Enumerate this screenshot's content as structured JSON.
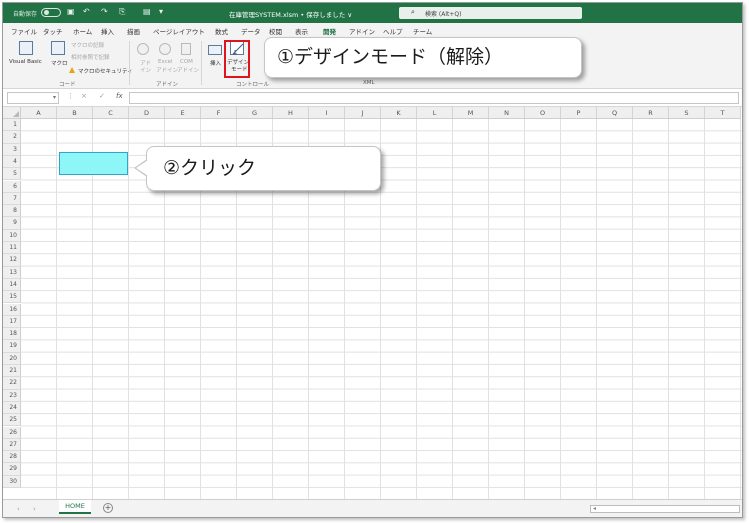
{
  "colors": {
    "title_bar": "#217346",
    "button_shape": "#8ff6f7",
    "highlight": "#e0141c"
  },
  "title_bar": {
    "autosave": "自動保存",
    "autosave_state": "オフ",
    "filename": "在庫管理SYSTEM.xlsm • 保存しました ∨",
    "search_placeholder": "検索 (Alt+Q)"
  },
  "menu_tabs": [
    "ファイル",
    "タッチ",
    "ホーム",
    "挿入",
    "描画",
    "ページレイアウト",
    "数式",
    "データ",
    "校閲",
    "表示",
    "開発",
    "アドイン",
    "ヘルプ",
    "チーム"
  ],
  "active_tab": "開発",
  "ribbon": {
    "code": {
      "visual_basic": "Visual Basic",
      "macro": "マクロ",
      "record_macro": "マクロの記録",
      "relative_ref": "相対参照で記録",
      "macro_security": "マクロのセキュリティ",
      "group_label": "コード"
    },
    "addins": {
      "addins_label": [
        "アド",
        "イン"
      ],
      "excel_addins": [
        "Excel",
        "アドイン"
      ],
      "com_addins": [
        "COM",
        "アドイン"
      ],
      "group_label": "アドイン"
    },
    "controls": {
      "insert": "挿入",
      "design_mode": [
        "デザイン",
        "モード"
      ],
      "group_label": "コントロール"
    },
    "xml_group_label": "XML"
  },
  "formula_bar": {
    "fx": "fx",
    "cancel": "×",
    "enter": "✓"
  },
  "columns": [
    "A",
    "B",
    "C",
    "D",
    "E",
    "F",
    "G",
    "H",
    "I",
    "J",
    "K",
    "L",
    "M",
    "N",
    "O",
    "P",
    "Q",
    "R",
    "S",
    "T"
  ],
  "rows": [
    "1",
    "2",
    "3",
    "4",
    "5",
    "6",
    "7",
    "8",
    "9",
    "10",
    "11",
    "12",
    "13",
    "14",
    "15",
    "16",
    "17",
    "18",
    "19",
    "20",
    "21",
    "22",
    "23",
    "24",
    "25",
    "26",
    "27",
    "28",
    "29",
    "30"
  ],
  "sheet_tabs": {
    "active": "HOME",
    "add": "+"
  },
  "callouts": {
    "step1": "①デザインモード（解除）",
    "step2": "②クリック"
  }
}
